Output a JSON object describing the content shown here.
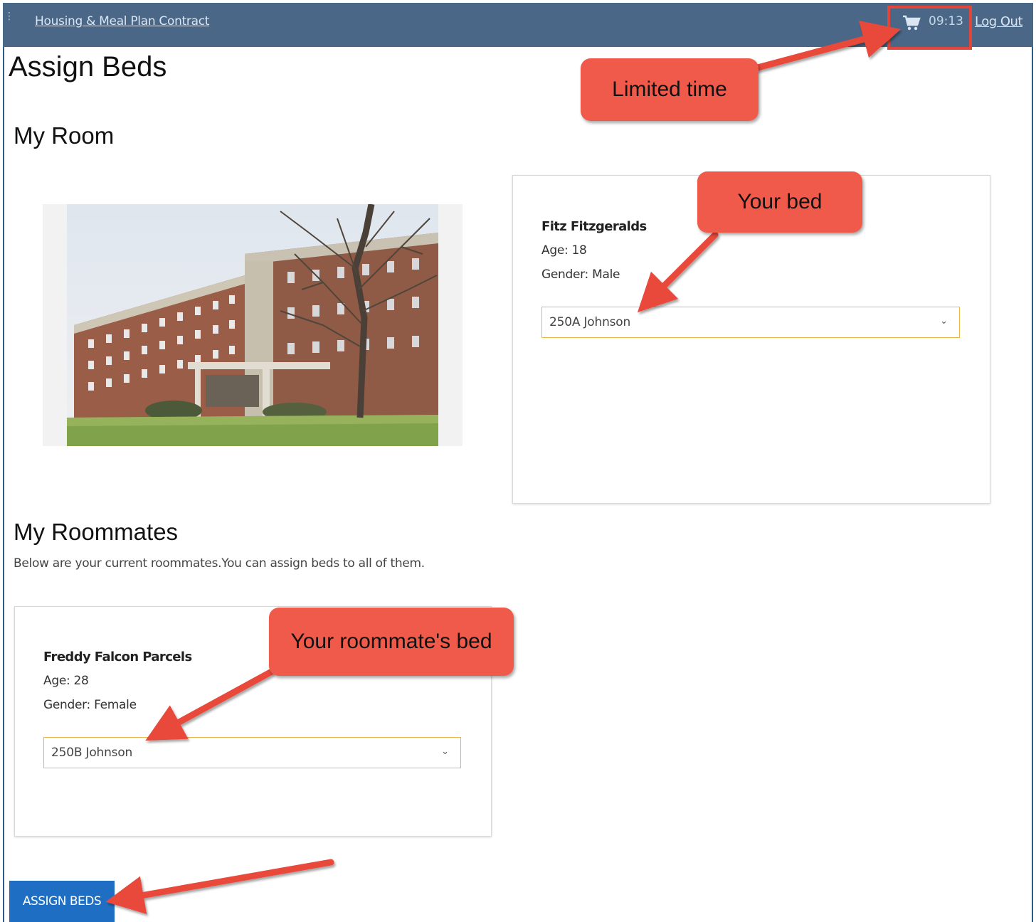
{
  "header": {
    "contract_link": "Housing & Meal Plan Contract",
    "timer": "09:13",
    "logout": "Log Out",
    "cart_icon": "shopping-cart-icon"
  },
  "page": {
    "title": "Assign Beds"
  },
  "my_room": {
    "heading": "My Room",
    "you": {
      "name": "Fitz Fitzgeralds",
      "age": "Age: 18",
      "gender": "Gender: Male",
      "bed": "250A Johnson"
    }
  },
  "roommates": {
    "heading": "My Roommates",
    "intro": "Below are your current roommates.You can assign beds to all of them.",
    "items": [
      {
        "name": "Freddy Falcon Parcels",
        "age": "Age: 28",
        "gender": "Gender: Female",
        "bed": "250B Johnson"
      }
    ]
  },
  "actions": {
    "assign_beds": "ASSIGN BEDS"
  },
  "annotations": {
    "limited_time": "Limited time",
    "your_bed": "Your bed",
    "roommate_bed": "Your roommate's bed"
  },
  "colors": {
    "topbar": "#4a6787",
    "callout": "#f05a4a",
    "arrow": "#e8493a",
    "button": "#1e6fc4",
    "select_border": "#e8b84a"
  }
}
